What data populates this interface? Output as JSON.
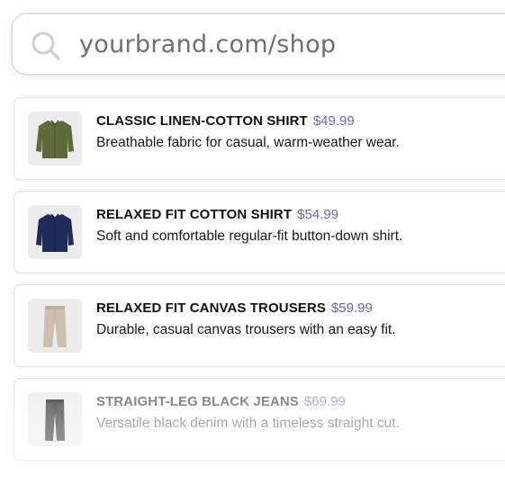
{
  "search": {
    "icon": "search-icon",
    "query": "yourbrand.com/shop"
  },
  "results": [
    {
      "name": "CLASSIC LINEN-COTTON SHIRT",
      "price": "$49.99",
      "description": "Breathable fabric for casual, warm-weather wear.",
      "image": "olive-shirt-image",
      "color": "#5f6a3a"
    },
    {
      "name": "RELAXED FIT COTTON SHIRT",
      "price": "$54.99",
      "description": "Soft and comfortable regular-fit button-down shirt.",
      "image": "navy-shirt-image",
      "color": "#1f2c5a"
    },
    {
      "name": "RELAXED FIT CANVAS TROUSERS",
      "price": "$59.99",
      "description": "Durable, casual canvas trousers with an easy fit.",
      "image": "beige-trousers-image",
      "color": "#cdbfad"
    },
    {
      "name": "STRAIGHT-LEG BLACK JEANS",
      "price": "$69.99",
      "description": "Versatile black denim with a timeless straight cut.",
      "image": "black-jeans-image",
      "color": "#4a4a4a"
    }
  ],
  "colors": {
    "price": "#6a6aa0",
    "border": "#e2e2e2"
  }
}
